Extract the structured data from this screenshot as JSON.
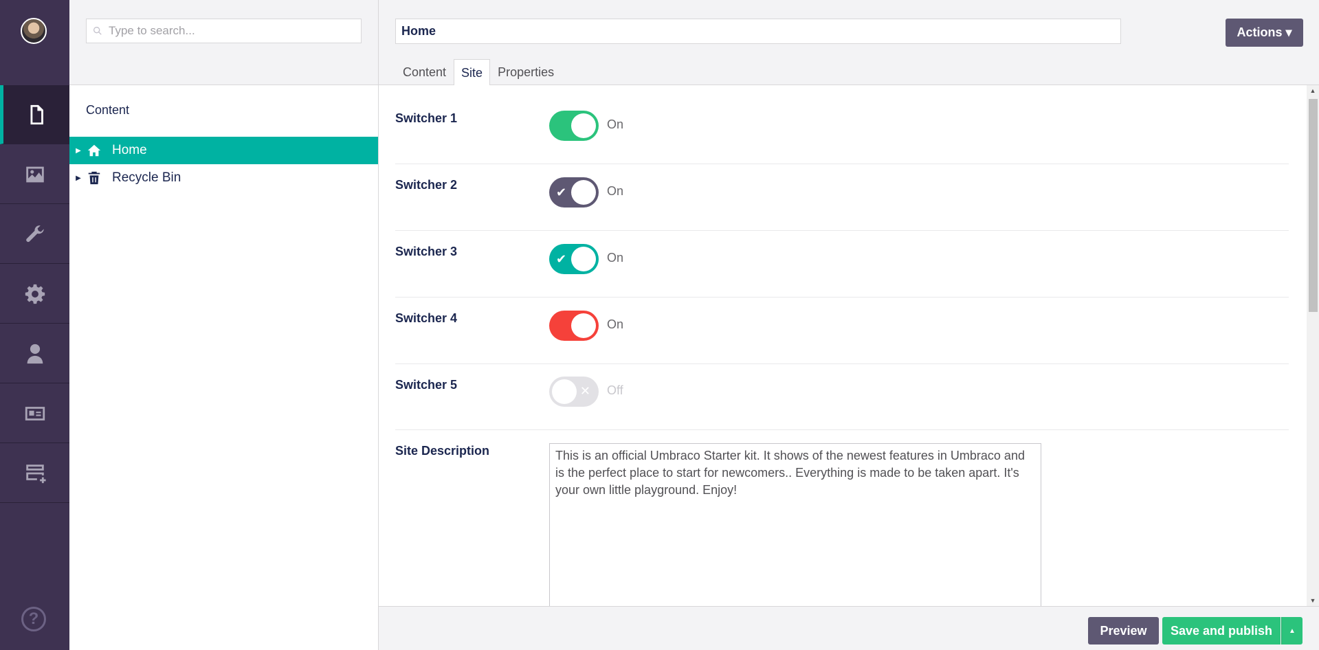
{
  "colors": {
    "rail_bg": "#3e3251",
    "accent_teal": "#00b2a2",
    "purple_btn": "#5e5873",
    "green_btn": "#2bc37c",
    "switch_green": "#2bc37c",
    "switch_purple": "#5e5873",
    "switch_teal": "#00b2a2",
    "switch_red": "#f5413a",
    "switch_off": "#e2e1e5"
  },
  "rail": {
    "items": [
      {
        "name": "content",
        "icon": "document-icon",
        "active": true
      },
      {
        "name": "media",
        "icon": "image-icon"
      },
      {
        "name": "settings",
        "icon": "wrench-icon"
      },
      {
        "name": "packages",
        "icon": "gear-icon"
      },
      {
        "name": "users",
        "icon": "user-icon"
      },
      {
        "name": "members",
        "icon": "id-card-icon"
      },
      {
        "name": "forms",
        "icon": "form-add-icon"
      }
    ],
    "help_label": "?"
  },
  "tree": {
    "search_placeholder": "Type to search...",
    "title": "Content",
    "nodes": [
      {
        "label": "Home",
        "icon": "home-icon",
        "selected": true
      },
      {
        "label": "Recycle Bin",
        "icon": "trash-icon",
        "selected": false
      }
    ]
  },
  "editor": {
    "name_value": "Home",
    "actions_label": "Actions ▾",
    "tabs": [
      "Content",
      "Site",
      "Properties"
    ],
    "active_tab": "Site",
    "properties": [
      {
        "label": "Switcher 1",
        "state": "On",
        "on": true,
        "color": "green",
        "check": false
      },
      {
        "label": "Switcher 2",
        "state": "On",
        "on": true,
        "color": "purple",
        "check": true
      },
      {
        "label": "Switcher 3",
        "state": "On",
        "on": true,
        "color": "teal",
        "check": true
      },
      {
        "label": "Switcher 4",
        "state": "On",
        "on": true,
        "color": "red",
        "check": false
      },
      {
        "label": "Switcher 5",
        "state": "Off",
        "on": false,
        "color": "off",
        "check": false
      }
    ],
    "description_label": "Site Description",
    "description_value": "This is an official Umbraco Starter kit. It shows of the newest features in Umbraco and is the perfect place to start for newcomers.. Everything is made to be taken apart. It's your own little playground. Enjoy!"
  },
  "footer": {
    "preview_label": "Preview",
    "publish_label": "Save and publish",
    "publish_caret": "▲"
  }
}
